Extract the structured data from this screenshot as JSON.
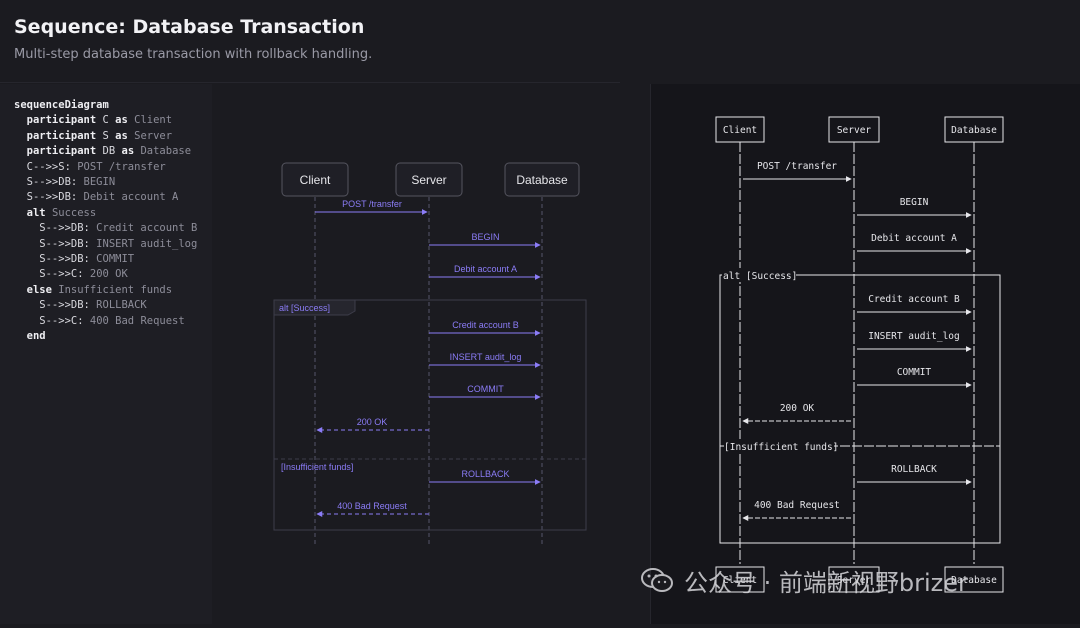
{
  "header": {
    "title": "Sequence: Database Transaction",
    "subtitle": "Multi-step database transaction with rollback handling."
  },
  "code": [
    [
      {
        "t": "sequenceDiagram",
        "c": "kw"
      }
    ],
    [
      {
        "t": "  participant ",
        "c": "kw"
      },
      {
        "t": "C",
        "c": "id"
      },
      {
        "t": " as ",
        "c": "kw"
      },
      {
        "t": "Client",
        "c": "val"
      }
    ],
    [
      {
        "t": "  participant ",
        "c": "kw"
      },
      {
        "t": "S",
        "c": "id"
      },
      {
        "t": " as ",
        "c": "kw"
      },
      {
        "t": "Server",
        "c": "val"
      }
    ],
    [
      {
        "t": "  participant ",
        "c": "kw"
      },
      {
        "t": "DB",
        "c": "id"
      },
      {
        "t": " as ",
        "c": "kw"
      },
      {
        "t": "Database",
        "c": "val"
      }
    ],
    [
      {
        "t": "  C-->>S:",
        "c": "id"
      },
      {
        "t": " POST /transfer",
        "c": "val"
      }
    ],
    [
      {
        "t": "  S-->>DB:",
        "c": "id"
      },
      {
        "t": " BEGIN",
        "c": "val"
      }
    ],
    [
      {
        "t": "  S-->>DB:",
        "c": "id"
      },
      {
        "t": " Debit account A",
        "c": "val"
      }
    ],
    [
      {
        "t": "  alt ",
        "c": "kw"
      },
      {
        "t": "Success",
        "c": "val"
      }
    ],
    [
      {
        "t": "    S-->>DB:",
        "c": "id"
      },
      {
        "t": " Credit account B",
        "c": "val"
      }
    ],
    [
      {
        "t": "    S-->>DB:",
        "c": "id"
      },
      {
        "t": " INSERT audit_log",
        "c": "val"
      }
    ],
    [
      {
        "t": "    S-->>DB:",
        "c": "id"
      },
      {
        "t": " COMMIT",
        "c": "val"
      }
    ],
    [
      {
        "t": "    S-->>C:",
        "c": "id"
      },
      {
        "t": " 200 OK",
        "c": "val"
      }
    ],
    [
      {
        "t": "  else ",
        "c": "kw"
      },
      {
        "t": "Insufficient funds",
        "c": "val"
      }
    ],
    [
      {
        "t": "    S-->>DB:",
        "c": "id"
      },
      {
        "t": " ROLLBACK",
        "c": "val"
      }
    ],
    [
      {
        "t": "    S-->>C:",
        "c": "id"
      },
      {
        "t": " 400 Bad Request",
        "c": "val"
      }
    ],
    [
      {
        "t": "  end",
        "c": "kw"
      }
    ]
  ],
  "diagram": {
    "participants": [
      "Client",
      "Server",
      "Database"
    ],
    "alt_label": "alt [Success]",
    "else_label": "[Insufficient funds]",
    "ascii_alt_label": "alt [Success]",
    "ascii_else_label": "[Insufficient funds]",
    "messages": [
      {
        "from": 0,
        "to": 1,
        "label": "POST /transfer",
        "dashed": false
      },
      {
        "from": 1,
        "to": 2,
        "label": "BEGIN",
        "dashed": false
      },
      {
        "from": 1,
        "to": 2,
        "label": "Debit account A",
        "dashed": false
      },
      {
        "from": 1,
        "to": 2,
        "label": "Credit account B",
        "dashed": false
      },
      {
        "from": 1,
        "to": 2,
        "label": "INSERT audit_log",
        "dashed": false
      },
      {
        "from": 1,
        "to": 2,
        "label": "COMMIT",
        "dashed": false
      },
      {
        "from": 1,
        "to": 0,
        "label": "200 OK",
        "dashed": true
      },
      {
        "from": 1,
        "to": 2,
        "label": "ROLLBACK",
        "dashed": false
      },
      {
        "from": 1,
        "to": 0,
        "label": "400 Bad Request",
        "dashed": true
      }
    ]
  },
  "watermark": {
    "text": "公众号 · 前端新视野brizer",
    "icon": "wechat-icon"
  },
  "colors": {
    "accent": "#8b7cf6",
    "panel": "#1e1e24",
    "ascii_fg": "#e6e6ea"
  }
}
